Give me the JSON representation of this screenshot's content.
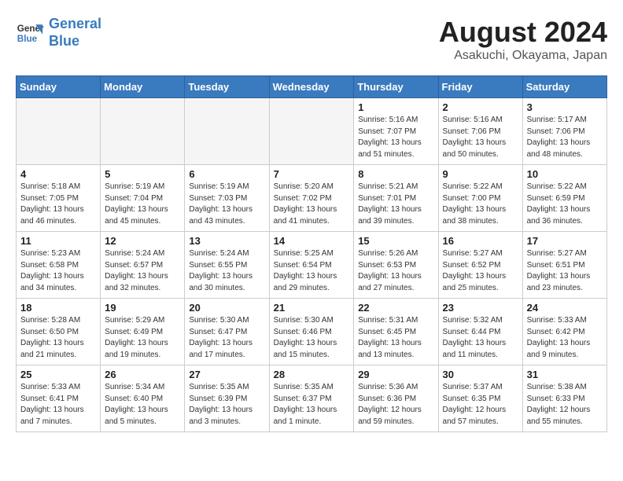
{
  "header": {
    "logo_line1": "General",
    "logo_line2": "Blue",
    "month_year": "August 2024",
    "location": "Asakuchi, Okayama, Japan"
  },
  "weekdays": [
    "Sunday",
    "Monday",
    "Tuesday",
    "Wednesday",
    "Thursday",
    "Friday",
    "Saturday"
  ],
  "weeks": [
    [
      {
        "day": "",
        "info": ""
      },
      {
        "day": "",
        "info": ""
      },
      {
        "day": "",
        "info": ""
      },
      {
        "day": "",
        "info": ""
      },
      {
        "day": "1",
        "info": "Sunrise: 5:16 AM\nSunset: 7:07 PM\nDaylight: 13 hours\nand 51 minutes."
      },
      {
        "day": "2",
        "info": "Sunrise: 5:16 AM\nSunset: 7:06 PM\nDaylight: 13 hours\nand 50 minutes."
      },
      {
        "day": "3",
        "info": "Sunrise: 5:17 AM\nSunset: 7:06 PM\nDaylight: 13 hours\nand 48 minutes."
      }
    ],
    [
      {
        "day": "4",
        "info": "Sunrise: 5:18 AM\nSunset: 7:05 PM\nDaylight: 13 hours\nand 46 minutes."
      },
      {
        "day": "5",
        "info": "Sunrise: 5:19 AM\nSunset: 7:04 PM\nDaylight: 13 hours\nand 45 minutes."
      },
      {
        "day": "6",
        "info": "Sunrise: 5:19 AM\nSunset: 7:03 PM\nDaylight: 13 hours\nand 43 minutes."
      },
      {
        "day": "7",
        "info": "Sunrise: 5:20 AM\nSunset: 7:02 PM\nDaylight: 13 hours\nand 41 minutes."
      },
      {
        "day": "8",
        "info": "Sunrise: 5:21 AM\nSunset: 7:01 PM\nDaylight: 13 hours\nand 39 minutes."
      },
      {
        "day": "9",
        "info": "Sunrise: 5:22 AM\nSunset: 7:00 PM\nDaylight: 13 hours\nand 38 minutes."
      },
      {
        "day": "10",
        "info": "Sunrise: 5:22 AM\nSunset: 6:59 PM\nDaylight: 13 hours\nand 36 minutes."
      }
    ],
    [
      {
        "day": "11",
        "info": "Sunrise: 5:23 AM\nSunset: 6:58 PM\nDaylight: 13 hours\nand 34 minutes."
      },
      {
        "day": "12",
        "info": "Sunrise: 5:24 AM\nSunset: 6:57 PM\nDaylight: 13 hours\nand 32 minutes."
      },
      {
        "day": "13",
        "info": "Sunrise: 5:24 AM\nSunset: 6:55 PM\nDaylight: 13 hours\nand 30 minutes."
      },
      {
        "day": "14",
        "info": "Sunrise: 5:25 AM\nSunset: 6:54 PM\nDaylight: 13 hours\nand 29 minutes."
      },
      {
        "day": "15",
        "info": "Sunrise: 5:26 AM\nSunset: 6:53 PM\nDaylight: 13 hours\nand 27 minutes."
      },
      {
        "day": "16",
        "info": "Sunrise: 5:27 AM\nSunset: 6:52 PM\nDaylight: 13 hours\nand 25 minutes."
      },
      {
        "day": "17",
        "info": "Sunrise: 5:27 AM\nSunset: 6:51 PM\nDaylight: 13 hours\nand 23 minutes."
      }
    ],
    [
      {
        "day": "18",
        "info": "Sunrise: 5:28 AM\nSunset: 6:50 PM\nDaylight: 13 hours\nand 21 minutes."
      },
      {
        "day": "19",
        "info": "Sunrise: 5:29 AM\nSunset: 6:49 PM\nDaylight: 13 hours\nand 19 minutes."
      },
      {
        "day": "20",
        "info": "Sunrise: 5:30 AM\nSunset: 6:47 PM\nDaylight: 13 hours\nand 17 minutes."
      },
      {
        "day": "21",
        "info": "Sunrise: 5:30 AM\nSunset: 6:46 PM\nDaylight: 13 hours\nand 15 minutes."
      },
      {
        "day": "22",
        "info": "Sunrise: 5:31 AM\nSunset: 6:45 PM\nDaylight: 13 hours\nand 13 minutes."
      },
      {
        "day": "23",
        "info": "Sunrise: 5:32 AM\nSunset: 6:44 PM\nDaylight: 13 hours\nand 11 minutes."
      },
      {
        "day": "24",
        "info": "Sunrise: 5:33 AM\nSunset: 6:42 PM\nDaylight: 13 hours\nand 9 minutes."
      }
    ],
    [
      {
        "day": "25",
        "info": "Sunrise: 5:33 AM\nSunset: 6:41 PM\nDaylight: 13 hours\nand 7 minutes."
      },
      {
        "day": "26",
        "info": "Sunrise: 5:34 AM\nSunset: 6:40 PM\nDaylight: 13 hours\nand 5 minutes."
      },
      {
        "day": "27",
        "info": "Sunrise: 5:35 AM\nSunset: 6:39 PM\nDaylight: 13 hours\nand 3 minutes."
      },
      {
        "day": "28",
        "info": "Sunrise: 5:35 AM\nSunset: 6:37 PM\nDaylight: 13 hours\nand 1 minute."
      },
      {
        "day": "29",
        "info": "Sunrise: 5:36 AM\nSunset: 6:36 PM\nDaylight: 12 hours\nand 59 minutes."
      },
      {
        "day": "30",
        "info": "Sunrise: 5:37 AM\nSunset: 6:35 PM\nDaylight: 12 hours\nand 57 minutes."
      },
      {
        "day": "31",
        "info": "Sunrise: 5:38 AM\nSunset: 6:33 PM\nDaylight: 12 hours\nand 55 minutes."
      }
    ]
  ]
}
